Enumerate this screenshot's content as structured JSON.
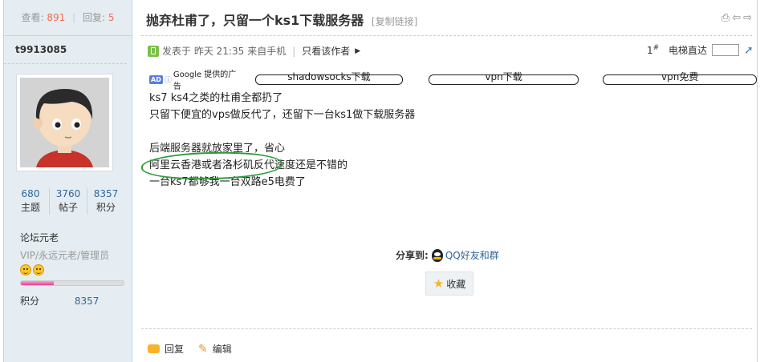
{
  "stats": {
    "views_label": "查看:",
    "views": "891",
    "sep": "|",
    "replies_label": "回复:",
    "replies": "5"
  },
  "author": {
    "name": "t9913085"
  },
  "user_counts": [
    {
      "value": "680",
      "label": "主题"
    },
    {
      "value": "3760",
      "label": "帖子"
    },
    {
      "value": "8357",
      "label": "积分"
    }
  ],
  "user": {
    "rank": "论坛元老",
    "group": "VIP/永远元老/管理员",
    "progress": 0.32,
    "points_label": "积分",
    "points": "8357"
  },
  "thread": {
    "title": "抛弃杜甫了，只留一个ks1下载服务器",
    "copy_link": "[复制链接]"
  },
  "post_meta": {
    "posted": "发表于 昨天 21:35",
    "source": "来自手机",
    "sep": "|",
    "author_only": "只看该作者",
    "floor": "1",
    "floor_sup": "#",
    "elevator": "电梯直达"
  },
  "ads": {
    "badge": "AD",
    "provider": "Google 提供的广告",
    "items": [
      "shadowsocks下载",
      "vpn下载",
      "vpn免费"
    ]
  },
  "content": [
    "ks7 ks4之类的杜甫全都扔了",
    "只留下便宜的vps做反代了，还留下一台ks1做下载服务器",
    "",
    "后端服务器就放家里了，省心",
    "阿里云香港或者洛杉矶反代速度还是不错的",
    "一台ks7都够我一台双路e5电费了"
  ],
  "share": {
    "label": "分享到:",
    "target": "QQ好友和群"
  },
  "favorite": {
    "label": "收藏"
  },
  "actions": {
    "reply": "回复",
    "edit": "编辑"
  },
  "colors": {
    "accent_link": "#336699",
    "highlight_circle": "#2f9b3c",
    "sidebar_bg": "#e5edf2"
  }
}
